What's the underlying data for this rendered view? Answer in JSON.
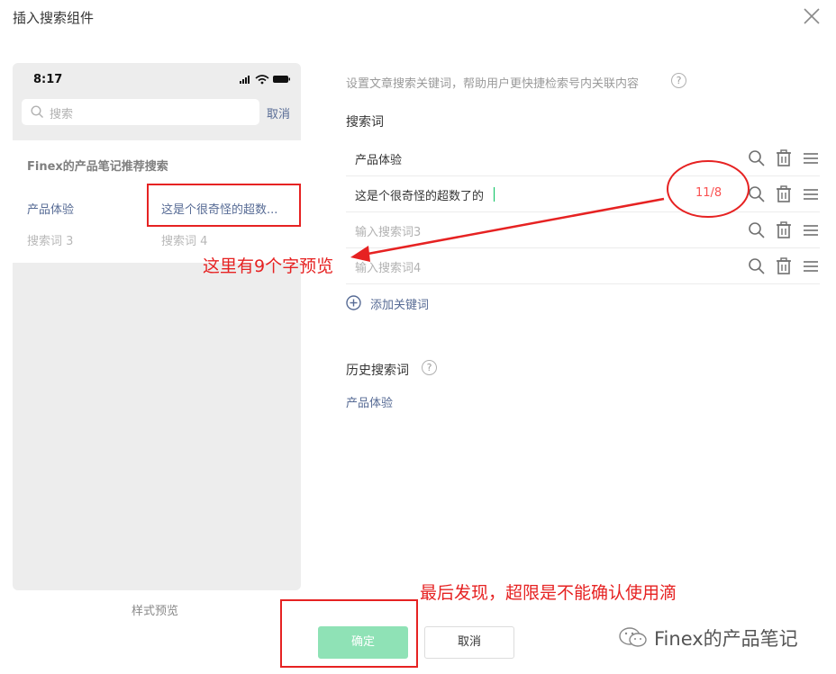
{
  "dialog": {
    "title": "插入搜索组件",
    "close_icon": "close-icon"
  },
  "preview": {
    "status_time": "8:17",
    "status_icons": [
      "signal-icon",
      "wifi-icon",
      "battery-icon"
    ],
    "search_placeholder": "搜索",
    "cancel_label": "取消",
    "panel_heading": "Finex的产品笔记推荐搜索",
    "items": [
      {
        "label": "产品体验",
        "state": "filled"
      },
      {
        "label": "这是个很奇怪的超数...",
        "state": "filled"
      },
      {
        "label": "搜索词 3",
        "state": "empty"
      },
      {
        "label": "搜索词 4",
        "state": "empty"
      }
    ],
    "caption": "样式预览"
  },
  "form": {
    "hint": "设置文章搜索关键词，帮助用户更快捷检索号内关联内容",
    "help_mark": "?",
    "keywords_label": "搜索词",
    "keywords": [
      {
        "value": "产品体验",
        "placeholder": "",
        "counter": ""
      },
      {
        "value": "这是个很奇怪的超数了的",
        "placeholder": "",
        "counter": "11/8"
      },
      {
        "value": "",
        "placeholder": "输入搜索词3",
        "counter": ""
      },
      {
        "value": "",
        "placeholder": "输入搜索词4",
        "counter": ""
      }
    ],
    "row_icons": [
      "search-icon",
      "trash-icon",
      "drag-handle-icon"
    ],
    "add_label": "添加关键词",
    "history_label": "历史搜索词",
    "history_items": [
      "产品体验"
    ]
  },
  "buttons": {
    "confirm_label": "确定",
    "cancel_label": "取消"
  },
  "annotations": {
    "note_preview": "这里有9个字预览",
    "note_confirm": "最后发现，超限是不能确认使用滴",
    "color": "#e62222"
  },
  "watermark": {
    "text": "Finex的产品笔记"
  },
  "colors": {
    "link": "#576b95",
    "confirm_disabled": "#8fe2b6",
    "error": "#fa5151"
  }
}
